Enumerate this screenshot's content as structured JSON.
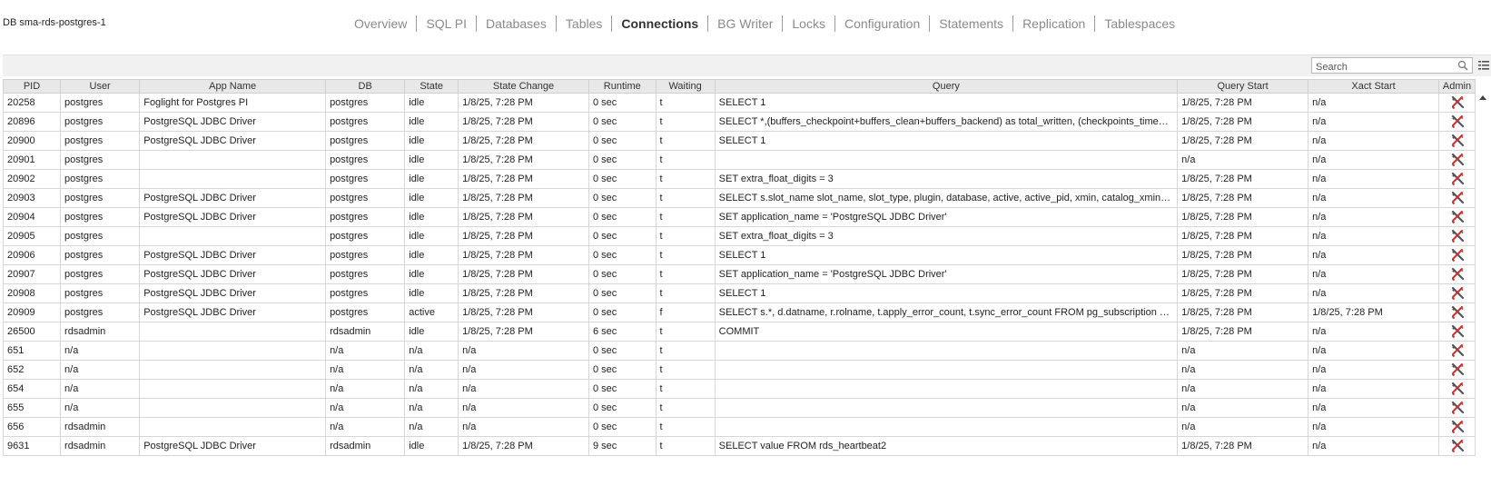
{
  "header": {
    "db_title": "DB sma-rds-postgres-1"
  },
  "nav": {
    "tabs": [
      {
        "label": "Overview"
      },
      {
        "label": "SQL PI"
      },
      {
        "label": "Databases"
      },
      {
        "label": "Tables"
      },
      {
        "label": "Connections",
        "active": true
      },
      {
        "label": "BG Writer"
      },
      {
        "label": "Locks"
      },
      {
        "label": "Configuration"
      },
      {
        "label": "Statements"
      },
      {
        "label": "Replication"
      },
      {
        "label": "Tablespaces"
      }
    ]
  },
  "toolbar": {
    "search_placeholder": "Search",
    "search_icon": "search-icon",
    "settings_icon": "column-settings-icon"
  },
  "colors": {
    "header_bg": "#e8e8e8",
    "toolbar_bg": "#f1f1f1",
    "admin_red": "#d32f2f",
    "active_tab": "#333333",
    "inactive_tab": "#8a8a8a"
  },
  "table": {
    "columns": [
      "PID",
      "User",
      "App Name",
      "DB",
      "State",
      "State Change",
      "Runtime",
      "Waiting",
      "Query",
      "Query Start",
      "Xact Start",
      "Admin"
    ],
    "rows": [
      {
        "pid": "20258",
        "user": "postgres",
        "app": "Foglight for Postgres PI",
        "db": "postgres",
        "state": "idle",
        "state_change": "1/8/25, 7:28 PM",
        "runtime": "0 sec",
        "waiting": "t",
        "query": "SELECT 1",
        "query_start": "1/8/25, 7:28 PM",
        "xact_start": "n/a"
      },
      {
        "pid": "20896",
        "user": "postgres",
        "app": "PostgreSQL JDBC Driver",
        "db": "postgres",
        "state": "idle",
        "state_change": "1/8/25, 7:28 PM",
        "runtime": "0 sec",
        "waiting": "t",
        "query": "SELECT *,(buffers_checkpoint+buffers_clean+buffers_backend) as total_written, (checkpoints_timed+c...",
        "query_start": "1/8/25, 7:28 PM",
        "xact_start": "n/a"
      },
      {
        "pid": "20900",
        "user": "postgres",
        "app": "PostgreSQL JDBC Driver",
        "db": "postgres",
        "state": "idle",
        "state_change": "1/8/25, 7:28 PM",
        "runtime": "0 sec",
        "waiting": "t",
        "query": "SELECT 1",
        "query_start": "1/8/25, 7:28 PM",
        "xact_start": "n/a"
      },
      {
        "pid": "20901",
        "user": "postgres",
        "app": "",
        "db": "postgres",
        "state": "idle",
        "state_change": "1/8/25, 7:28 PM",
        "runtime": "0 sec",
        "waiting": "t",
        "query": "",
        "query_start": "n/a",
        "xact_start": "n/a"
      },
      {
        "pid": "20902",
        "user": "postgres",
        "app": "",
        "db": "postgres",
        "state": "idle",
        "state_change": "1/8/25, 7:28 PM",
        "runtime": "0 sec",
        "waiting": "t",
        "query": "SET extra_float_digits = 3",
        "query_start": "1/8/25, 7:28 PM",
        "xact_start": "n/a"
      },
      {
        "pid": "20903",
        "user": "postgres",
        "app": "PostgreSQL JDBC Driver",
        "db": "postgres",
        "state": "idle",
        "state_change": "1/8/25, 7:28 PM",
        "runtime": "0 sec",
        "waiting": "t",
        "query": "SELECT s.slot_name slot_name, slot_type, plugin, database, active, active_pid, xmin, catalog_xmin, rest...",
        "query_start": "1/8/25, 7:28 PM",
        "xact_start": "n/a"
      },
      {
        "pid": "20904",
        "user": "postgres",
        "app": "PostgreSQL JDBC Driver",
        "db": "postgres",
        "state": "idle",
        "state_change": "1/8/25, 7:28 PM",
        "runtime": "0 sec",
        "waiting": "t",
        "query": "SET application_name = 'PostgreSQL JDBC Driver'",
        "query_start": "1/8/25, 7:28 PM",
        "xact_start": "n/a"
      },
      {
        "pid": "20905",
        "user": "postgres",
        "app": "",
        "db": "postgres",
        "state": "idle",
        "state_change": "1/8/25, 7:28 PM",
        "runtime": "0 sec",
        "waiting": "t",
        "query": "SET extra_float_digits = 3",
        "query_start": "1/8/25, 7:28 PM",
        "xact_start": "n/a"
      },
      {
        "pid": "20906",
        "user": "postgres",
        "app": "PostgreSQL JDBC Driver",
        "db": "postgres",
        "state": "idle",
        "state_change": "1/8/25, 7:28 PM",
        "runtime": "0 sec",
        "waiting": "t",
        "query": "SELECT 1",
        "query_start": "1/8/25, 7:28 PM",
        "xact_start": "n/a"
      },
      {
        "pid": "20907",
        "user": "postgres",
        "app": "PostgreSQL JDBC Driver",
        "db": "postgres",
        "state": "idle",
        "state_change": "1/8/25, 7:28 PM",
        "runtime": "0 sec",
        "waiting": "t",
        "query": "SET application_name = 'PostgreSQL JDBC Driver'",
        "query_start": "1/8/25, 7:28 PM",
        "xact_start": "n/a"
      },
      {
        "pid": "20908",
        "user": "postgres",
        "app": "PostgreSQL JDBC Driver",
        "db": "postgres",
        "state": "idle",
        "state_change": "1/8/25, 7:28 PM",
        "runtime": "0 sec",
        "waiting": "t",
        "query": "SELECT 1",
        "query_start": "1/8/25, 7:28 PM",
        "xact_start": "n/a"
      },
      {
        "pid": "20909",
        "user": "postgres",
        "app": "PostgreSQL JDBC Driver",
        "db": "postgres",
        "state": "active",
        "state_change": "1/8/25, 7:28 PM",
        "runtime": "0 sec",
        "waiting": "f",
        "query": "SELECT s.*, d.datname, r.rolname, t.apply_error_count, t.sync_error_count FROM pg_subscription s LEF...",
        "query_start": "1/8/25, 7:28 PM",
        "xact_start": "1/8/25, 7:28 PM"
      },
      {
        "pid": "26500",
        "user": "rdsadmin",
        "app": "",
        "db": "rdsadmin",
        "state": "idle",
        "state_change": "1/8/25, 7:28 PM",
        "runtime": "6 sec",
        "waiting": "t",
        "query": "COMMIT",
        "query_start": "1/8/25, 7:28 PM",
        "xact_start": "n/a"
      },
      {
        "pid": "651",
        "user": "n/a",
        "app": "",
        "db": "n/a",
        "state": "n/a",
        "state_change": "n/a",
        "runtime": "0 sec",
        "waiting": "t",
        "query": "",
        "query_start": "n/a",
        "xact_start": "n/a"
      },
      {
        "pid": "652",
        "user": "n/a",
        "app": "",
        "db": "n/a",
        "state": "n/a",
        "state_change": "n/a",
        "runtime": "0 sec",
        "waiting": "t",
        "query": "",
        "query_start": "n/a",
        "xact_start": "n/a"
      },
      {
        "pid": "654",
        "user": "n/a",
        "app": "",
        "db": "n/a",
        "state": "n/a",
        "state_change": "n/a",
        "runtime": "0 sec",
        "waiting": "t",
        "query": "",
        "query_start": "n/a",
        "xact_start": "n/a"
      },
      {
        "pid": "655",
        "user": "n/a",
        "app": "",
        "db": "n/a",
        "state": "n/a",
        "state_change": "n/a",
        "runtime": "0 sec",
        "waiting": "t",
        "query": "",
        "query_start": "n/a",
        "xact_start": "n/a"
      },
      {
        "pid": "656",
        "user": "rdsadmin",
        "app": "",
        "db": "n/a",
        "state": "n/a",
        "state_change": "n/a",
        "runtime": "0 sec",
        "waiting": "t",
        "query": "",
        "query_start": "n/a",
        "xact_start": "n/a"
      },
      {
        "pid": "9631",
        "user": "rdsadmin",
        "app": "PostgreSQL JDBC Driver",
        "db": "rdsadmin",
        "state": "idle",
        "state_change": "1/8/25, 7:28 PM",
        "runtime": "9 sec",
        "waiting": "t",
        "query": "SELECT value FROM rds_heartbeat2",
        "query_start": "1/8/25, 7:28 PM",
        "xact_start": "n/a"
      }
    ]
  }
}
